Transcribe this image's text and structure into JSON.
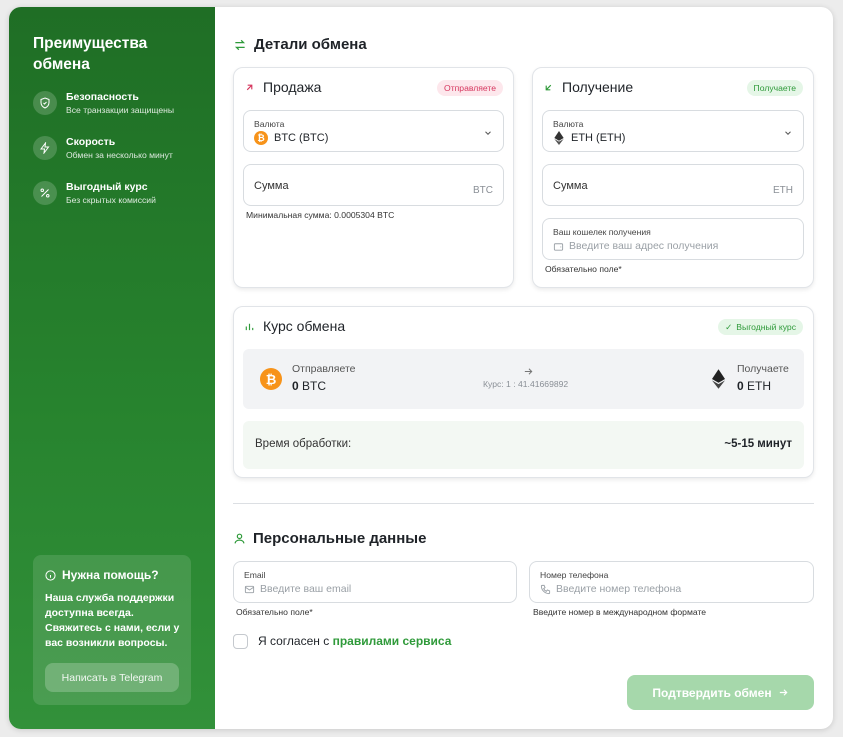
{
  "sidebar": {
    "title": "Преимущества обмена",
    "features": [
      {
        "title": "Безопасность",
        "subtitle": "Все транзакции защищены",
        "icon": "shield-icon"
      },
      {
        "title": "Скорость",
        "subtitle": "Обмен за несколько минут",
        "icon": "lightning-icon"
      },
      {
        "title": "Выгодный курс",
        "subtitle": "Без скрытых комиссий",
        "icon": "percent-icon"
      }
    ],
    "help": {
      "title": "Нужна помощь?",
      "text": "Наша служба поддержки доступна всегда. Свяжитесь с нами, если у вас возникли вопросы.",
      "button": "Написать в Telegram"
    }
  },
  "exchange": {
    "heading": "Детали обмена",
    "sell": {
      "title": "Продажа",
      "badge": "Отправляете",
      "currency_label": "Валюта",
      "currency_value": "BTC (BTC)",
      "amount_label": "Сумма",
      "amount_unit": "BTC",
      "min_hint": "Минимальная сумма: 0.0005304 BTC"
    },
    "receive": {
      "title": "Получение",
      "badge": "Получаете",
      "currency_label": "Валюта",
      "currency_value": "ETH (ETH)",
      "amount_label": "Сумма",
      "amount_unit": "ETH",
      "wallet_label": "Ваш кошелек получения",
      "wallet_placeholder": "Введите ваш адрес получения",
      "required_hint": "Обязательно поле*"
    }
  },
  "rate": {
    "title": "Курс обмена",
    "badge": "Выгодный курс",
    "send_label": "Отправляете",
    "send_amount": "0",
    "send_unit": "BTC",
    "rate_text": "Курс: 1 : 41.41669892",
    "receive_label": "Получаете",
    "receive_amount": "0",
    "receive_unit": "ETH",
    "time_label": "Время обработки:",
    "time_value": "~5-15 минут"
  },
  "personal": {
    "heading": "Персональные данные",
    "email_label": "Email",
    "email_placeholder": "Введите ваш email",
    "email_hint": "Обязательно поле*",
    "phone_label": "Номер телефона",
    "phone_placeholder": "Введите номер телефона",
    "phone_hint": "Введите номер в международном формате",
    "agree_text": "Я согласен с ",
    "agree_link": "правилами сервиса",
    "submit": "Подтвердить обмен"
  },
  "colors": {
    "accent": "#2f9a3a",
    "sidebar": "#27832e",
    "btc": "#f7931a",
    "badge_pink": "#d6365e"
  }
}
